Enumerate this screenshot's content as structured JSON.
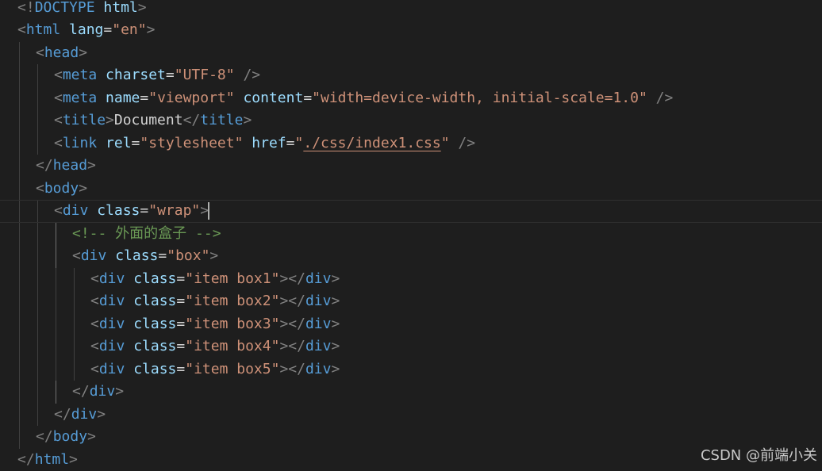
{
  "lines": [
    {
      "indent": 0,
      "tokens": [
        {
          "t": "punct",
          "v": "<!"
        },
        {
          "t": "doctype",
          "v": "DOCTYPE "
        },
        {
          "t": "doctype-kw",
          "v": "html"
        },
        {
          "t": "punct",
          "v": ">"
        }
      ]
    },
    {
      "indent": 0,
      "tokens": [
        {
          "t": "punct",
          "v": "<"
        },
        {
          "t": "tag",
          "v": "html "
        },
        {
          "t": "attr",
          "v": "lang"
        },
        {
          "t": "eq",
          "v": "="
        },
        {
          "t": "str",
          "v": "\"en\""
        },
        {
          "t": "punct",
          "v": ">"
        }
      ]
    },
    {
      "indent": 1,
      "tokens": [
        {
          "t": "punct",
          "v": "<"
        },
        {
          "t": "tag",
          "v": "head"
        },
        {
          "t": "punct",
          "v": ">"
        }
      ]
    },
    {
      "indent": 2,
      "tokens": [
        {
          "t": "punct",
          "v": "<"
        },
        {
          "t": "tag",
          "v": "meta "
        },
        {
          "t": "attr",
          "v": "charset"
        },
        {
          "t": "eq",
          "v": "="
        },
        {
          "t": "str",
          "v": "\"UTF-8\""
        },
        {
          "t": "text",
          "v": " "
        },
        {
          "t": "punct",
          "v": "/>"
        }
      ]
    },
    {
      "indent": 2,
      "tokens": [
        {
          "t": "punct",
          "v": "<"
        },
        {
          "t": "tag",
          "v": "meta "
        },
        {
          "t": "attr",
          "v": "name"
        },
        {
          "t": "eq",
          "v": "="
        },
        {
          "t": "str",
          "v": "\"viewport\""
        },
        {
          "t": "text",
          "v": " "
        },
        {
          "t": "attr",
          "v": "content"
        },
        {
          "t": "eq",
          "v": "="
        },
        {
          "t": "str",
          "v": "\"width=device-width, initial-scale=1.0\""
        },
        {
          "t": "text",
          "v": " "
        },
        {
          "t": "punct",
          "v": "/>"
        }
      ]
    },
    {
      "indent": 2,
      "tokens": [
        {
          "t": "punct",
          "v": "<"
        },
        {
          "t": "tag",
          "v": "title"
        },
        {
          "t": "punct",
          "v": ">"
        },
        {
          "t": "text",
          "v": "Document"
        },
        {
          "t": "punct",
          "v": "</"
        },
        {
          "t": "tag",
          "v": "title"
        },
        {
          "t": "punct",
          "v": ">"
        }
      ]
    },
    {
      "indent": 2,
      "tokens": [
        {
          "t": "punct",
          "v": "<"
        },
        {
          "t": "tag",
          "v": "link "
        },
        {
          "t": "attr",
          "v": "rel"
        },
        {
          "t": "eq",
          "v": "="
        },
        {
          "t": "str",
          "v": "\"stylesheet\""
        },
        {
          "t": "text",
          "v": " "
        },
        {
          "t": "attr",
          "v": "href"
        },
        {
          "t": "eq",
          "v": "="
        },
        {
          "t": "str",
          "v": "\""
        },
        {
          "t": "link",
          "v": "./css/index1.css"
        },
        {
          "t": "str",
          "v": "\""
        },
        {
          "t": "text",
          "v": " "
        },
        {
          "t": "punct",
          "v": "/>"
        }
      ]
    },
    {
      "indent": 1,
      "tokens": [
        {
          "t": "punct",
          "v": "</"
        },
        {
          "t": "tag",
          "v": "head"
        },
        {
          "t": "punct",
          "v": ">"
        }
      ]
    },
    {
      "indent": 1,
      "tokens": [
        {
          "t": "punct",
          "v": "<"
        },
        {
          "t": "tag",
          "v": "body"
        },
        {
          "t": "punct",
          "v": ">"
        }
      ]
    },
    {
      "indent": 2,
      "active": true,
      "tokens": [
        {
          "t": "punct",
          "v": "<"
        },
        {
          "t": "tag",
          "v": "div "
        },
        {
          "t": "attr",
          "v": "class"
        },
        {
          "t": "eq",
          "v": "="
        },
        {
          "t": "str",
          "v": "\"wrap\""
        },
        {
          "t": "punct",
          "v": ">"
        },
        {
          "t": "cursor",
          "v": ""
        }
      ]
    },
    {
      "indent": 3,
      "tokens": [
        {
          "t": "comment",
          "v": "<!-- 外面的盒子 -->"
        }
      ]
    },
    {
      "indent": 3,
      "tokens": [
        {
          "t": "punct",
          "v": "<"
        },
        {
          "t": "tag",
          "v": "div "
        },
        {
          "t": "attr",
          "v": "class"
        },
        {
          "t": "eq",
          "v": "="
        },
        {
          "t": "str",
          "v": "\"box\""
        },
        {
          "t": "punct",
          "v": ">"
        }
      ]
    },
    {
      "indent": 4,
      "tokens": [
        {
          "t": "punct",
          "v": "<"
        },
        {
          "t": "tag",
          "v": "div "
        },
        {
          "t": "attr",
          "v": "class"
        },
        {
          "t": "eq",
          "v": "="
        },
        {
          "t": "str",
          "v": "\"item box1\""
        },
        {
          "t": "punct",
          "v": "></"
        },
        {
          "t": "tag",
          "v": "div"
        },
        {
          "t": "punct",
          "v": ">"
        }
      ]
    },
    {
      "indent": 4,
      "tokens": [
        {
          "t": "punct",
          "v": "<"
        },
        {
          "t": "tag",
          "v": "div "
        },
        {
          "t": "attr",
          "v": "class"
        },
        {
          "t": "eq",
          "v": "="
        },
        {
          "t": "str",
          "v": "\"item box2\""
        },
        {
          "t": "punct",
          "v": "></"
        },
        {
          "t": "tag",
          "v": "div"
        },
        {
          "t": "punct",
          "v": ">"
        }
      ]
    },
    {
      "indent": 4,
      "tokens": [
        {
          "t": "punct",
          "v": "<"
        },
        {
          "t": "tag",
          "v": "div "
        },
        {
          "t": "attr",
          "v": "class"
        },
        {
          "t": "eq",
          "v": "="
        },
        {
          "t": "str",
          "v": "\"item box3\""
        },
        {
          "t": "punct",
          "v": "></"
        },
        {
          "t": "tag",
          "v": "div"
        },
        {
          "t": "punct",
          "v": ">"
        }
      ]
    },
    {
      "indent": 4,
      "tokens": [
        {
          "t": "punct",
          "v": "<"
        },
        {
          "t": "tag",
          "v": "div "
        },
        {
          "t": "attr",
          "v": "class"
        },
        {
          "t": "eq",
          "v": "="
        },
        {
          "t": "str",
          "v": "\"item box4\""
        },
        {
          "t": "punct",
          "v": "></"
        },
        {
          "t": "tag",
          "v": "div"
        },
        {
          "t": "punct",
          "v": ">"
        }
      ]
    },
    {
      "indent": 4,
      "tokens": [
        {
          "t": "punct",
          "v": "<"
        },
        {
          "t": "tag",
          "v": "div "
        },
        {
          "t": "attr",
          "v": "class"
        },
        {
          "t": "eq",
          "v": "="
        },
        {
          "t": "str",
          "v": "\"item box5\""
        },
        {
          "t": "punct",
          "v": "></"
        },
        {
          "t": "tag",
          "v": "div"
        },
        {
          "t": "punct",
          "v": ">"
        }
      ]
    },
    {
      "indent": 3,
      "tokens": [
        {
          "t": "punct",
          "v": "</"
        },
        {
          "t": "tag",
          "v": "div"
        },
        {
          "t": "punct",
          "v": ">"
        }
      ]
    },
    {
      "indent": 2,
      "tokens": [
        {
          "t": "punct",
          "v": "</"
        },
        {
          "t": "tag",
          "v": "div"
        },
        {
          "t": "punct",
          "v": ">"
        }
      ]
    },
    {
      "indent": 1,
      "tokens": [
        {
          "t": "punct",
          "v": "</"
        },
        {
          "t": "tag",
          "v": "body"
        },
        {
          "t": "punct",
          "v": ">"
        }
      ]
    },
    {
      "indent": 0,
      "tokens": [
        {
          "t": "punct",
          "v": "</"
        },
        {
          "t": "tag",
          "v": "html"
        },
        {
          "t": "punct",
          "v": ">"
        }
      ]
    }
  ],
  "watermark": "CSDN @前端小关",
  "colors": {
    "background": "#1e1e1e",
    "tag": "#569cd6",
    "attribute": "#9cdcfe",
    "string": "#ce9178",
    "comment": "#6a9955",
    "punctuation": "#808080",
    "text": "#d4d4d4"
  }
}
